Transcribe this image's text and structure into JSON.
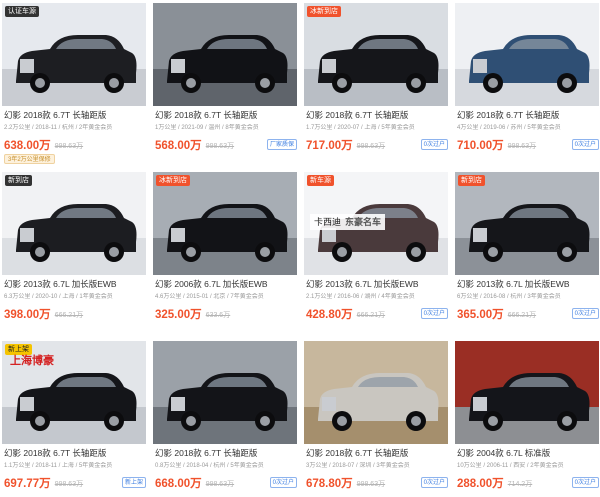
{
  "listings": [
    {
      "badge": "认证车源",
      "badge_color": "#333333",
      "bg": "#e6e9ee",
      "ground": "#c9ccd2",
      "car": "#1d1e22",
      "title": "幻影 2018款 6.7T 长轴距版",
      "meta": "2.2万公里 / 2018-11 / 杭州 / 2年黄金会员",
      "price": "638.00万",
      "old_price": "998.63万",
      "tag": "",
      "extra": "3年2万公里保修"
    },
    {
      "badge": "",
      "bg": "#8a9097",
      "ground": "#5f646b",
      "car": "#111216",
      "title": "幻影 2018款 6.7T 长轴距版",
      "meta": "1万公里 / 2021-09 / 温州 / 8年黄金会员",
      "price": "568.00万",
      "old_price": "998.63万",
      "tag": "厂家质保"
    },
    {
      "badge": "冰新到店",
      "badge_color": "#f0522c",
      "bg": "#d9dde2",
      "ground": "#b9bec5",
      "car": "#15161a",
      "title": "幻影 2018款 6.7T 长轴距版",
      "meta": "1.7万公里 / 2020-07 / 上海 / 5年黄金会员",
      "price": "717.00万",
      "old_price": "998.63万",
      "tag": "0次过户"
    },
    {
      "badge": "",
      "bg": "#eef0f3",
      "ground": "#d6d9de",
      "car": "#2f4f74",
      "title": "幻影 2018款 6.7T 长轴距版",
      "meta": "4万公里 / 2019-06 / 苏州 / 5年黄金会员",
      "price": "710.00万",
      "old_price": "998.63万",
      "tag": "0次过户"
    },
    {
      "badge": "新到店",
      "badge_color": "#333333",
      "bg": "#f1f2f4",
      "ground": "#dcdfe3",
      "car": "#1c1d21",
      "title": "幻影 2013款 6.7L 加长版EWB",
      "meta": "6.3万公里 / 2020-10 / 上海 / 1年黄金会员",
      "price": "398.00万",
      "old_price": "666.21万",
      "tag": ""
    },
    {
      "badge": "冰新到店",
      "badge_color": "#f0522c",
      "bg": "#a7adb4",
      "ground": "#7d838a",
      "car": "#121317",
      "title": "幻影 2006款 6.7L 加长版EWB",
      "meta": "4.6万公里 / 2015-01 / 北京 / 7年黄金会员",
      "price": "325.00万",
      "old_price": "633.6万",
      "tag": ""
    },
    {
      "badge": "新车源",
      "badge_color": "#f0522c",
      "bg": "#f4f5f7",
      "ground": "#e0e2e6",
      "car": "#4a3a3c",
      "overlay": "卡西迪",
      "overlay2": "东豪名车",
      "title": "幻影 2013款 6.7L 加长版EWB",
      "meta": "2.1万公里 / 2016-06 / 湖州 / 4年黄金会员",
      "price": "428.80万",
      "old_price": "666.21万",
      "tag": "0次过户"
    },
    {
      "badge": "新到店",
      "badge_color": "#f0522c",
      "bg": "#b2b7be",
      "ground": "#8c9198",
      "car": "#15161a",
      "title": "幻影 2013款 6.7L 加长版EWB",
      "meta": "6万公里 / 2016-08 / 杭州 / 3年黄金会员",
      "price": "365.00万",
      "old_price": "666.21万",
      "tag": "0次过户"
    },
    {
      "badge": "新上架",
      "badge_color": "#f5c400",
      "overlay_red": "上海博豪",
      "bg": "#e2e5e9",
      "ground": "#c4c8ce",
      "car": "#141519",
      "title": "幻影 2018款 6.7T 长轴距版",
      "meta": "1.1万公里 / 2018-11 / 上海 / 5年黄金会员",
      "price": "697.77万",
      "old_price": "998.63万",
      "tag": "新上架"
    },
    {
      "badge": "",
      "bg": "#9ba1a8",
      "ground": "#6e747b",
      "car": "#131418",
      "title": "幻影 2018款 6.7T 长轴距版",
      "meta": "0.8万公里 / 2018-04 / 杭州 / 5年黄金会员",
      "price": "668.00万",
      "old_price": "998.63万",
      "tag": "0次过户"
    },
    {
      "badge": "",
      "bg": "#c7b79d",
      "ground": "#a58f6d",
      "car": "#c9c6c0",
      "title": "幻影 2018款 6.7T 长轴距版",
      "meta": "3万公里 / 2018-07 / 深圳 / 3年黄金会员",
      "price": "678.80万",
      "old_price": "998.63万",
      "tag": "0次过户"
    },
    {
      "badge": "",
      "bg": "#9a2e24",
      "ground": "#8d8f93",
      "car": "#14151a",
      "title": "幻影 2004款 6.7L 标准版",
      "meta": "10万公里 / 2006-11 / 西安 / 2年黄金会员",
      "price": "288.00万",
      "old_price": "714.2万",
      "tag": "0次过户"
    }
  ]
}
